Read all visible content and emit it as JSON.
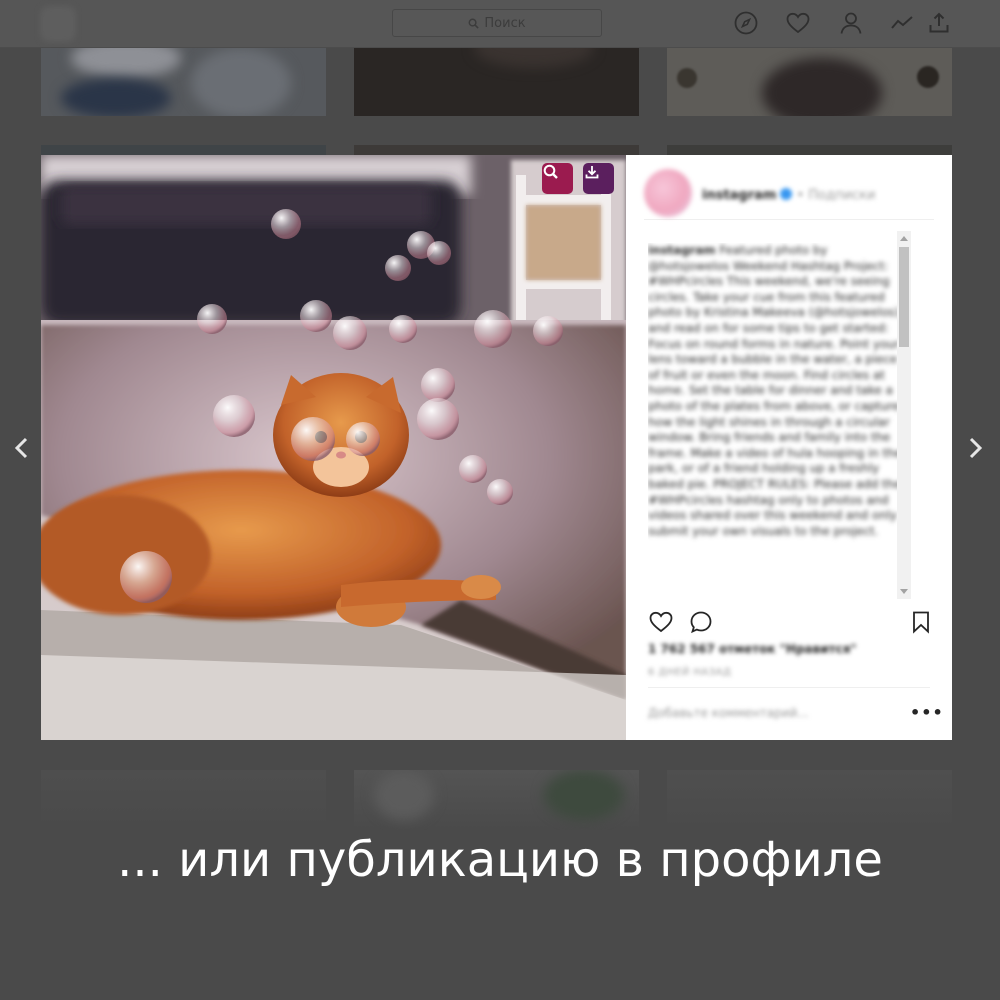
{
  "topbar": {
    "search_placeholder": "Поиск",
    "icons": [
      "compass-icon",
      "heart-icon",
      "profile-icon",
      "stats-icon",
      "upload-icon"
    ]
  },
  "modal": {
    "photo_buttons": [
      {
        "icon": "search-icon",
        "color": "#9b1b4f"
      },
      {
        "icon": "download-icon",
        "color": "#5b1f5e"
      }
    ],
    "header": {
      "username": "instagram",
      "follow": "• Подписки"
    },
    "caption": {
      "author": "instagram",
      "text": "Featured photo by @hotsjowelos Weekend Hashtag Project: #WHPcircles This weekend, we're seeing circles. Take your cue from this featured photo by Kristina Makeeva (@hotsjowelos), and read on for some tips to get started: Focus on round forms in nature. Point your lens toward a bubble in the water, a piece of fruit or even the moon. Find circles at home. Set the table for dinner and take a photo of the plates from above, or capture how the light shines in through a circular window. Bring friends and family into the frame. Make a video of hula hooping in the park, or of a friend holding up a freshly baked pie. PROJECT RULES: Please add the #WHPcircles hashtag only to photos and videos shared over this weekend and only submit your own visuals to the project."
    },
    "likes": "1 762 567 отметок \"Нравится\"",
    "timestamp": "6 ДНЕЙ НАЗАД",
    "comment_placeholder": "Добавьте комментарий...",
    "more_label": "•••"
  },
  "nav": {
    "prev_icon": "chevron-left-icon",
    "next_icon": "chevron-right-icon"
  },
  "headline": "... или публикацию в профиле"
}
